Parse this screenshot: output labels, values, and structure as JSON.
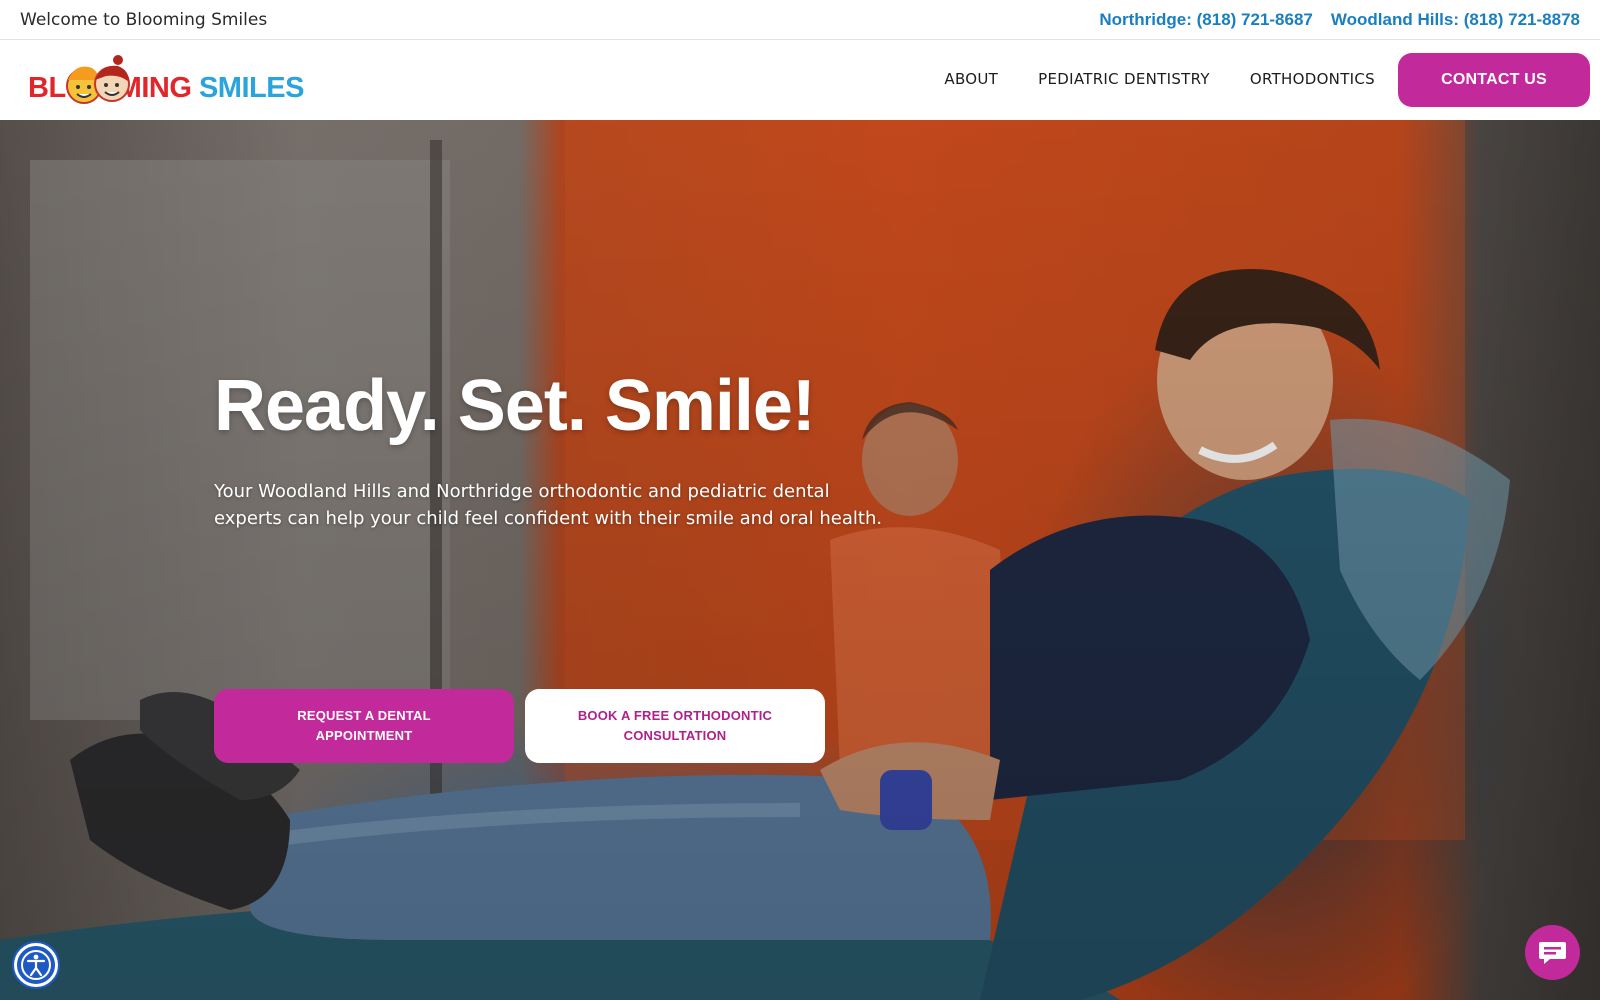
{
  "topbar": {
    "welcome": "Welcome to Blooming Smiles",
    "phones": [
      {
        "label": "Northridge: (818) 721-8687"
      },
      {
        "label": "Woodland Hills: (818) 721-8878"
      }
    ]
  },
  "header": {
    "logo": {
      "part1": "BL",
      "part2": "MING",
      "part3": "SMILES"
    },
    "nav": [
      {
        "label": "ABOUT"
      },
      {
        "label": "PEDIATRIC DENTISTRY"
      },
      {
        "label": "ORTHODONTICS"
      }
    ],
    "contact_label": "CONTACT US"
  },
  "hero": {
    "title": "Ready. Set. Smile!",
    "subtitle": "Your Woodland Hills and Northridge orthodontic and pediatric dental experts can help your child feel confident with their smile and oral health.",
    "buttons": [
      {
        "label": "REQUEST A DENTAL APPOINTMENT"
      },
      {
        "label": "BOOK A FREE ORTHODONTIC CONSULTATION"
      }
    ]
  },
  "widgets": {
    "accessibility_icon": "accessibility-icon",
    "chat_icon": "chat-bubble-icon"
  },
  "colors": {
    "brand_magenta": "#c2299a",
    "phone_blue": "#1a7fc1",
    "logo_red": "#e0262b",
    "logo_blue": "#2ba3dc"
  }
}
